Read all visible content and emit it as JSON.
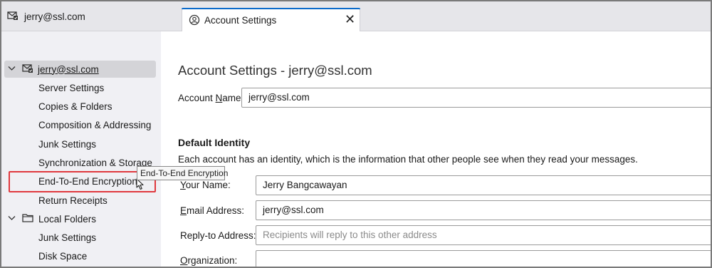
{
  "tabs": {
    "mail_tab_label": "jerry@ssl.com",
    "active_tab_label": "Account Settings",
    "close_glyph": "✕"
  },
  "sidebar": {
    "account_label": "jerry@ssl.com",
    "account_items": [
      "Server Settings",
      "Copies & Folders",
      "Composition & Addressing",
      "Junk Settings",
      "Synchronization & Storage",
      "End-To-End Encryption",
      "Return Receipts"
    ],
    "local_folders_label": "Local Folders",
    "local_items": [
      "Junk Settings",
      "Disk Space"
    ],
    "selected_item": "End-To-End Encryption",
    "tooltip": "End-To-End Encryption",
    "highlight_color": "#e0393e"
  },
  "main": {
    "title": "Account Settings - jerry@ssl.com",
    "account_name": {
      "prefix": "Account ",
      "mnemonic": "N",
      "suffix": "ame:",
      "value": "jerry@ssl.com"
    },
    "default_identity_title": "Default Identity",
    "default_identity_desc": "Each account has an identity, which is the information that other people see when they read your messages.",
    "your_name": {
      "mnemonic": "Y",
      "suffix": "our Name:",
      "value": "Jerry Bangcawayan"
    },
    "email": {
      "mnemonic": "E",
      "suffix": "mail Address:",
      "value": "jerry@ssl.com"
    },
    "reply_to": {
      "label": "Reply-to Address:",
      "placeholder": "Recipients will reply to this other address"
    },
    "organization": {
      "mnemonic": "O",
      "suffix": "rganization:",
      "value": ""
    }
  },
  "colors": {
    "accent": "#0b6bcb",
    "sidebar_bg": "#f0f0f4",
    "selected_bg": "#d4d4d8"
  },
  "icons": [
    "mail-account-icon",
    "account-settings-icon",
    "close-icon",
    "chevron-down-icon",
    "folder-icon",
    "mouse-cursor-icon"
  ]
}
